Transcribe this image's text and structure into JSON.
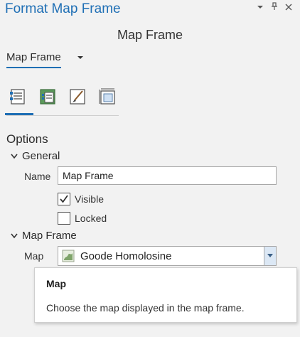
{
  "pane": {
    "title": "Format Map Frame",
    "controls": {
      "dropdown_icon": "chevron-down-icon",
      "pin_icon": "pin-icon",
      "close_icon": "close-icon",
      "dropdown_glyph": "▼",
      "pin_glyph": "📌",
      "close_glyph": "✕"
    }
  },
  "header": {
    "title": "Map Frame"
  },
  "element_selector": {
    "value": "Map Frame",
    "caret_glyph": "▼"
  },
  "tool_tabs": [
    {
      "name": "options-tab-icon",
      "active": true
    },
    {
      "name": "display-tab-icon",
      "active": false
    },
    {
      "name": "symbol-tab-icon",
      "active": false
    },
    {
      "name": "placement-tab-icon",
      "active": false
    }
  ],
  "options": {
    "heading": "Options",
    "general": {
      "header": "General",
      "name_label": "Name",
      "name_value": "Map Frame",
      "visible_label": "Visible",
      "visible_checked": true,
      "locked_label": "Locked",
      "locked_checked": false
    },
    "map_frame": {
      "header": "Map Frame",
      "map_label": "Map",
      "map_value": "Goode Homolosine"
    }
  },
  "tooltip": {
    "title": "Map",
    "body": "Choose the map displayed in the map frame."
  },
  "colors": {
    "accent": "#1f6fb5",
    "background": "#f2f2f2"
  }
}
